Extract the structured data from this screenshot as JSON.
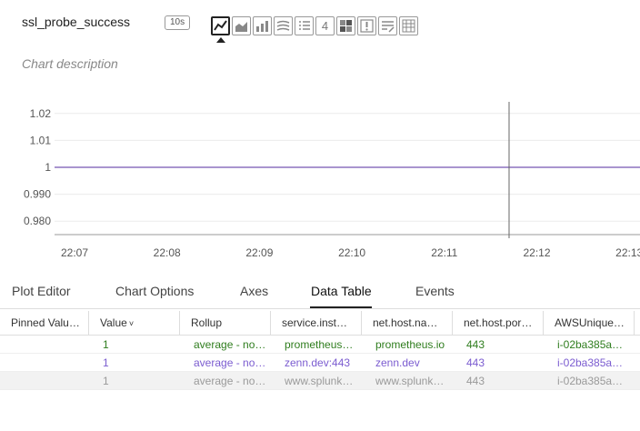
{
  "header": {
    "title": "ssl_probe_success",
    "resolution": "10s",
    "description": "Chart description"
  },
  "viz_icons": [
    {
      "name": "line-chart-icon",
      "active": true
    },
    {
      "name": "area-chart-icon",
      "active": false
    },
    {
      "name": "column-chart-icon",
      "active": false
    },
    {
      "name": "histogram-icon",
      "active": false
    },
    {
      "name": "list-icon",
      "active": false
    },
    {
      "name": "single-value-icon",
      "label": "4",
      "active": false
    },
    {
      "name": "heatmap-icon",
      "active": false
    },
    {
      "name": "event-feed-icon",
      "active": false
    },
    {
      "name": "text-note-icon",
      "active": false
    },
    {
      "name": "table-icon",
      "active": false
    }
  ],
  "chart_data": {
    "type": "line",
    "x": [
      "22:07",
      "22:08",
      "22:09",
      "22:10",
      "22:11",
      "22:12",
      "22:13"
    ],
    "series": [
      {
        "values": [
          1,
          1,
          1,
          1,
          1,
          1,
          1
        ],
        "color": "#a995cf"
      }
    ],
    "yticks": [
      "1.02",
      "1.01",
      "1",
      "0.990",
      "0.980"
    ],
    "ylim": [
      0.975,
      1.025
    ],
    "cursor_at": "22:11.7",
    "grid": true
  },
  "tabs": [
    "Plot Editor",
    "Chart Options",
    "Axes",
    "Data Table",
    "Events"
  ],
  "active_tab": "Data Table",
  "table": {
    "columns": [
      "Pinned Valu…",
      "Value",
      "Rollup",
      "service.inst…",
      "net.host.na…",
      "net.host.por…",
      "AWSUnique…"
    ],
    "rows": [
      [
        "",
        "1",
        "average - no…",
        "prometheus…",
        "prometheus.io",
        "443",
        "i-02ba385a…"
      ],
      [
        "",
        "1",
        "average - no…",
        "zenn.dev:443",
        "zenn.dev",
        "443",
        "i-02ba385a…"
      ],
      [
        "",
        "1",
        "average - no…",
        "www.splunk…",
        "www.splunk…",
        "443",
        "i-02ba385a…"
      ]
    ]
  }
}
